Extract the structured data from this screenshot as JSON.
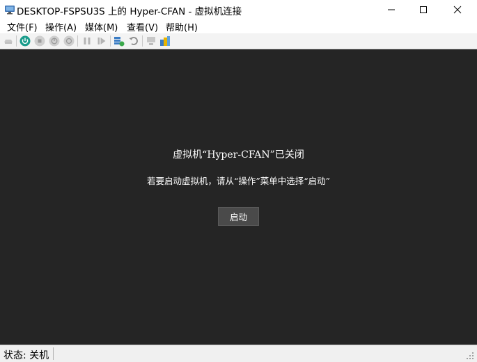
{
  "window": {
    "title": "DESKTOP-FSPSU3S 上的 Hyper-CFAN - 虚拟机连接",
    "controls": [
      "minimize-icon",
      "maximize-icon",
      "close-icon"
    ]
  },
  "menu": {
    "items": [
      {
        "label": "文件(F)"
      },
      {
        "label": "操作(A)"
      },
      {
        "label": "媒体(M)"
      },
      {
        "label": "查看(V)"
      },
      {
        "label": "帮助(H)"
      }
    ]
  },
  "toolbar": {
    "buttons": [
      {
        "icon": "ctrl-alt-del-icon",
        "enabled": false
      },
      {
        "icon": "start-icon",
        "enabled": true,
        "color": "#1a9c8c"
      },
      {
        "icon": "turn-off-icon",
        "enabled": false
      },
      {
        "icon": "shutdown-icon",
        "enabled": false
      },
      {
        "icon": "save-state-icon",
        "enabled": false
      },
      {
        "icon": "pause-icon",
        "enabled": false
      },
      {
        "icon": "resume-icon",
        "enabled": false
      },
      {
        "icon": "checkpoint-icon",
        "enabled": true
      },
      {
        "icon": "revert-icon",
        "enabled": true
      },
      {
        "icon": "enhanced-session-icon",
        "enabled": false
      },
      {
        "icon": "share-icon",
        "enabled": true
      }
    ]
  },
  "vm": {
    "state_title": "虚拟机“Hyper-CFAN”已关闭",
    "hint": "若要启动虚拟机，请从“操作”菜单中选择“启动”",
    "start_button": "启动",
    "background": "#252525"
  },
  "status": {
    "text": "状态: 关机"
  }
}
